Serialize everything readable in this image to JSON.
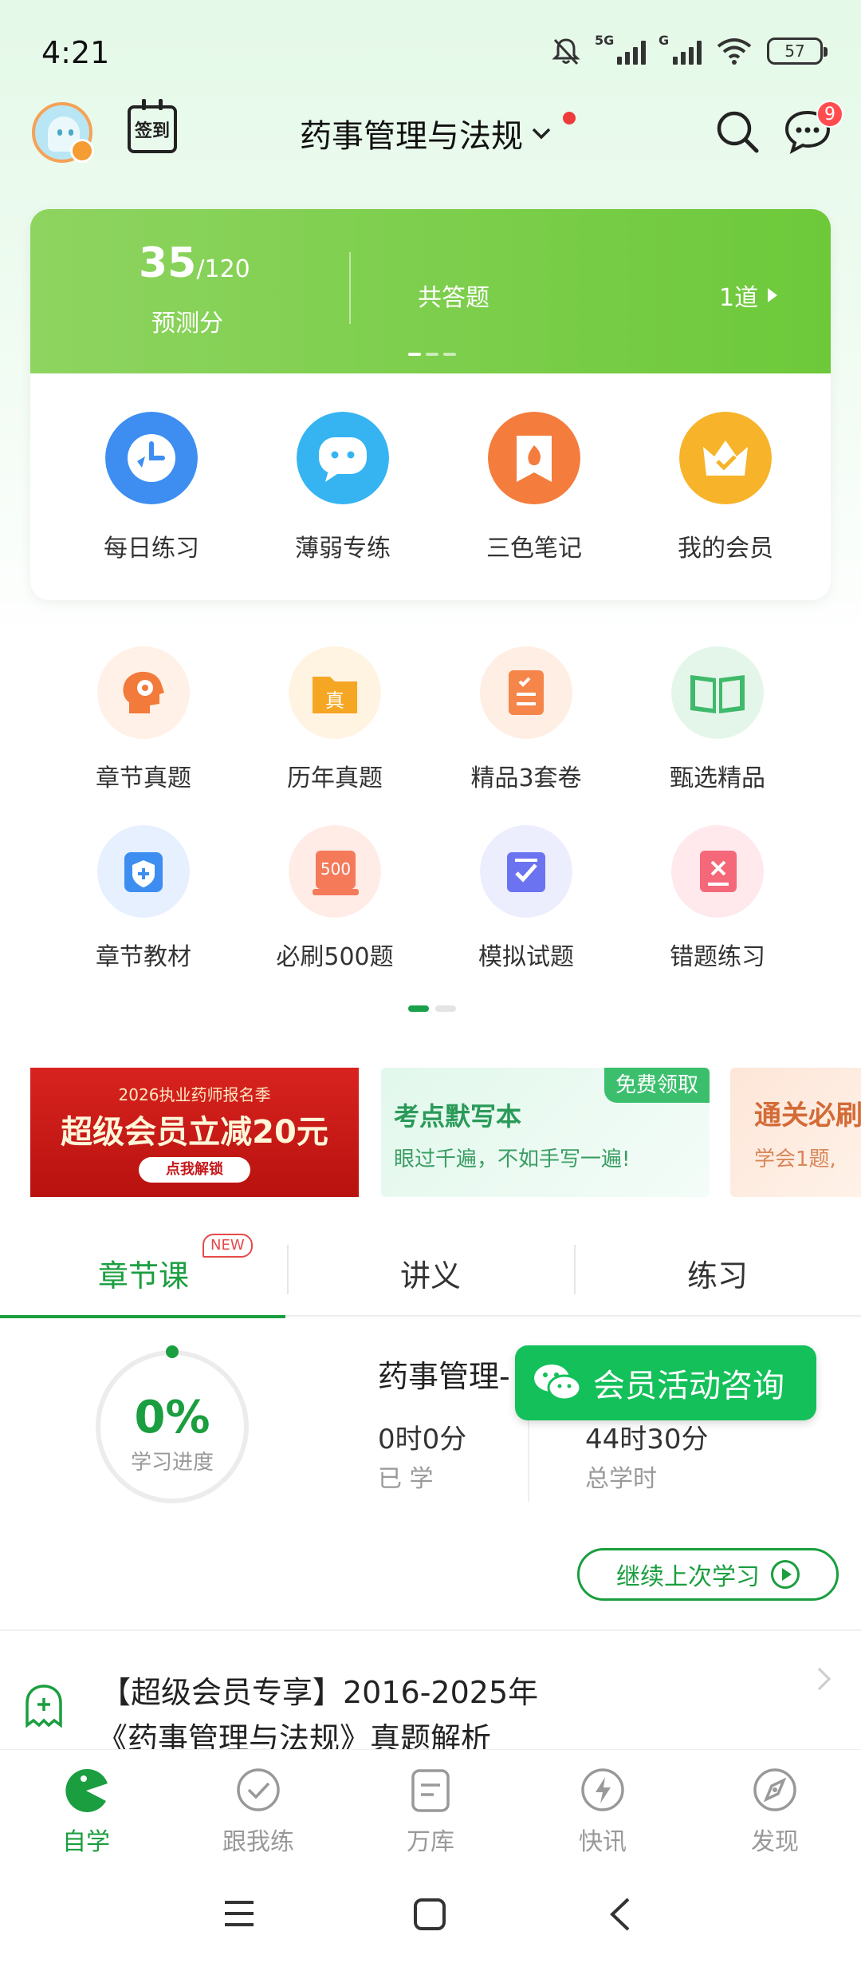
{
  "status_bar": {
    "time": "4:21",
    "network_label": "5G",
    "network2_label": "G",
    "battery": "57"
  },
  "header": {
    "title": "药事管理与法规",
    "checkin_label": "签到",
    "message_badge": "9"
  },
  "score_card": {
    "score": "35",
    "score_max": "/120",
    "score_label": "预测分",
    "center_label": "共答题",
    "right_label": "1道"
  },
  "quick_actions": [
    {
      "label": "每日练习",
      "icon": "clock-icon"
    },
    {
      "label": "薄弱专练",
      "icon": "chat-bubble-icon"
    },
    {
      "label": "三色笔记",
      "icon": "bookmark-flame-icon"
    },
    {
      "label": "我的会员",
      "icon": "crown-icon"
    }
  ],
  "grid_menu": [
    {
      "label": "章节真题",
      "icon": "head-gear-icon"
    },
    {
      "label": "历年真题",
      "icon": "folder-icon",
      "icon_text": "真"
    },
    {
      "label": "精品3套卷",
      "icon": "checklist-icon"
    },
    {
      "label": "甄选精品",
      "icon": "open-book-icon"
    },
    {
      "label": "章节教材",
      "icon": "shield-plus-icon"
    },
    {
      "label": "必刷500题",
      "icon": "card-500-icon",
      "icon_text": "500"
    },
    {
      "label": "模拟试题",
      "icon": "check-scroll-icon"
    },
    {
      "label": "错题练习",
      "icon": "error-card-icon"
    }
  ],
  "banners": {
    "b1_top": "2026执业药师报名季",
    "b1_main": "超级会员立减20元",
    "b1_button": "点我解锁",
    "b2_tag": "免费领取",
    "b2_title": "考点默写本",
    "b2_sub": "眼过千遍，不如手写一遍!",
    "b3_title": "通关必刷",
    "b3_sub": "学会1题,"
  },
  "tabs": [
    {
      "label": "章节课",
      "badge": "NEW"
    },
    {
      "label": "讲义"
    },
    {
      "label": "练习"
    }
  ],
  "course": {
    "progress_pct": "0%",
    "progress_label": "学习进度",
    "title": "药事管理-",
    "studied_value": "0时0分",
    "studied_label": "已 学",
    "total_value": "44时30分",
    "total_label": "总学时",
    "wechat_label": "会员活动咨询",
    "continue_label": "继续上次学习"
  },
  "promo": {
    "line1": "【超级会员专享】2016-2025年",
    "line2": "《药事管理与法规》真题解析"
  },
  "bottom_nav": [
    {
      "label": "自学",
      "icon": "pacman-icon"
    },
    {
      "label": "跟我练",
      "icon": "check-circle-icon"
    },
    {
      "label": "万库",
      "icon": "document-icon"
    },
    {
      "label": "快讯",
      "icon": "lightning-icon"
    },
    {
      "label": "发现",
      "icon": "compass-icon"
    }
  ],
  "colors": {
    "accent": "#1a9e3f",
    "score_band": "#6dc93a",
    "wechat": "#14c05a",
    "banner_red": "#d8231f"
  }
}
